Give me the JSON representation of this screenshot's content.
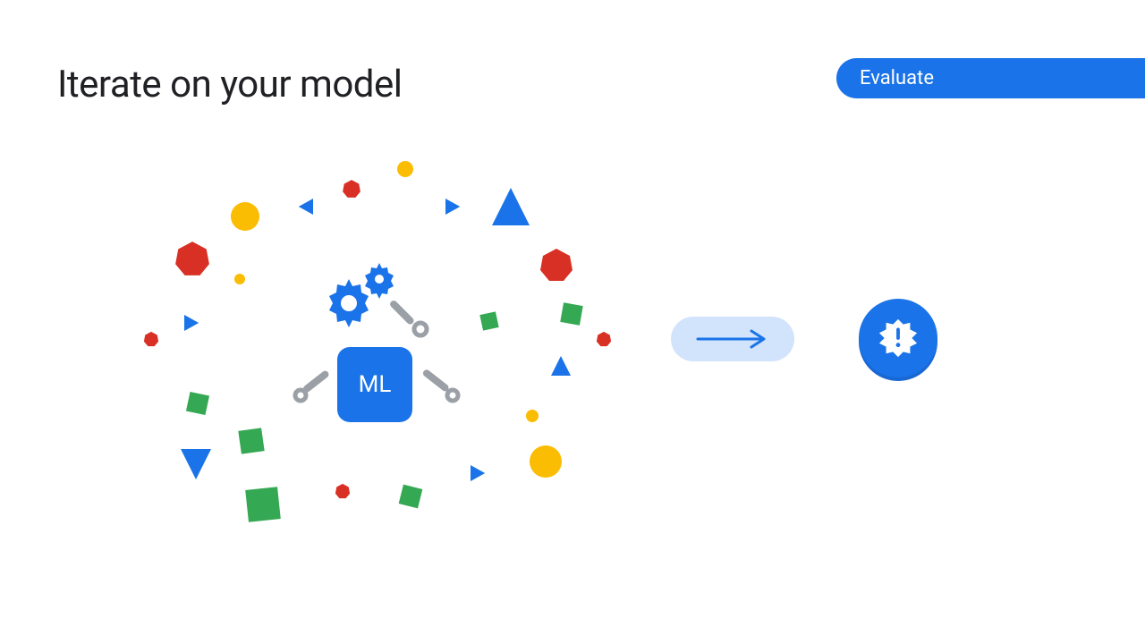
{
  "slide": {
    "title": "Iterate on your model",
    "badge_label": "Evaluate"
  },
  "ml_block": {
    "label": "ML"
  },
  "colors": {
    "blue": "#1a73e8",
    "blue_dark": "#1967d2",
    "blue_light": "#d2e3fc",
    "red": "#d93025",
    "green": "#34a853",
    "yellow": "#fbbc04",
    "grey": "#9aa0a6"
  }
}
